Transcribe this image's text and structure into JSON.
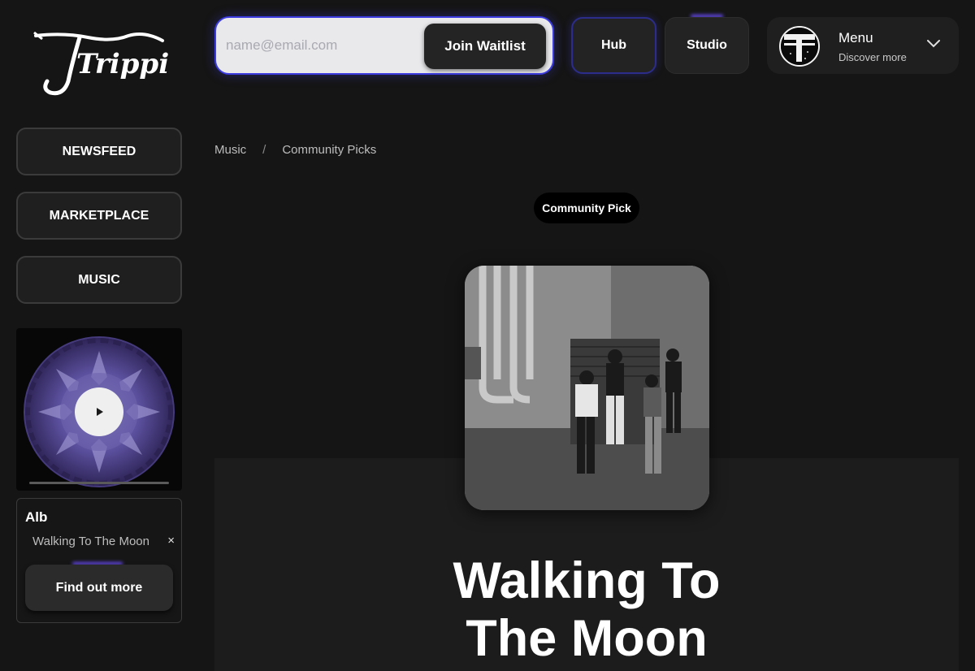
{
  "brand": {
    "logo_text": "Trippin'"
  },
  "waitlist": {
    "placeholder": "name@email.com",
    "button_label": "Join Waitlist"
  },
  "top_nav": {
    "hub_label": "Hub",
    "studio_label": "Studio"
  },
  "menu": {
    "title": "Menu",
    "subtitle": "Discover more",
    "icon": "chevron-down-icon"
  },
  "sidebar": {
    "items": [
      {
        "label": "NEWSFEED"
      },
      {
        "label": "MARKETPLACE"
      },
      {
        "label": "MUSIC"
      }
    ]
  },
  "player": {
    "icon": "play-icon",
    "progress": 0.0
  },
  "album_card": {
    "title": "Alb",
    "track": "Walking To The Moon",
    "close_glyph": "×",
    "button_label": "Find out more"
  },
  "breadcrumb": {
    "items": [
      "Music",
      "Community Picks"
    ],
    "separator": "/"
  },
  "main": {
    "badge": "Community Pick",
    "title_line1": "Walking To",
    "title_line2": "The Moon"
  },
  "colors": {
    "background": "#151515",
    "accent": "#3b3be0",
    "glow": "#6a4cf5",
    "card": "#1f1f1f"
  }
}
